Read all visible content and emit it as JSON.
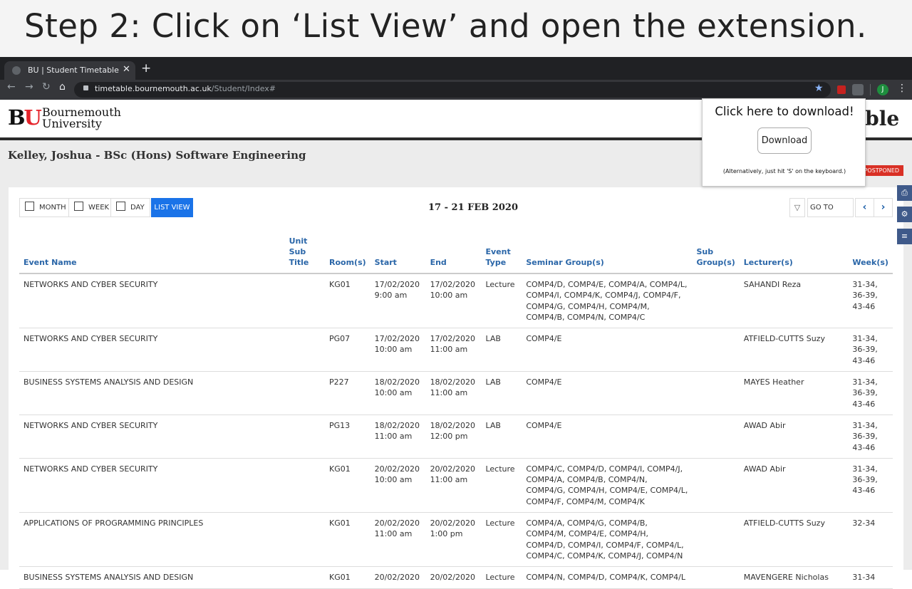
{
  "caption": "Step 2: Click on ‘List View’ and open the extension.",
  "browser": {
    "tab_title": "BU | Student Timetable",
    "url_host": "timetable.bournemouth.ac.uk",
    "url_path": "/Student/Index#",
    "profile_initial": "J"
  },
  "site": {
    "logo_b": "B",
    "logo_u": "U",
    "name_line1": "Bournemouth",
    "name_line2": "University",
    "title_partial": "able"
  },
  "student": "Kelley, Joshua - BSc (Hons) Software Engineering",
  "postponed": "POSTPONED",
  "views": {
    "month": "MONTH",
    "week": "WEEK",
    "day": "DAY",
    "list": "LIST VIEW"
  },
  "date_range": "17 - 21 FEB 2020",
  "goto_placeholder": "GO TO",
  "popup": {
    "title": "Click here to download!",
    "button": "Download",
    "note": "(Alternatively, just hit 'S' on the keyboard.)"
  },
  "table": {
    "headers": [
      "Event Name",
      "Unit Sub Title",
      "Room(s)",
      "Start",
      "End",
      "Event Type",
      "Seminar Group(s)",
      "Sub Group(s)",
      "Lecturer(s)",
      "Week(s)"
    ],
    "rows": [
      {
        "event": "NETWORKS AND CYBER SECURITY",
        "subtitle": "",
        "room": "KG01",
        "start": "17/02/2020 9:00 am",
        "end": "17/02/2020 10:00 am",
        "type": "Lecture",
        "groups": "COMP4/D, COMP4/E, COMP4/A, COMP4/L, COMP4/I, COMP4/K, COMP4/J, COMP4/F, COMP4/G, COMP4/H, COMP4/M, COMP4/B, COMP4/N, COMP4/C",
        "subgroups": "",
        "lecturer": "SAHANDI Reza",
        "weeks": "31-34, 36-39, 43-46"
      },
      {
        "event": "NETWORKS AND CYBER SECURITY",
        "subtitle": "",
        "room": "PG07",
        "start": "17/02/2020 10:00 am",
        "end": "17/02/2020 11:00 am",
        "type": "LAB",
        "groups": "COMP4/E",
        "subgroups": "",
        "lecturer": "ATFIELD-CUTTS Suzy",
        "weeks": "31-34, 36-39, 43-46"
      },
      {
        "event": "BUSINESS SYSTEMS ANALYSIS AND DESIGN",
        "subtitle": "",
        "room": "P227",
        "start": "18/02/2020 10:00 am",
        "end": "18/02/2020 11:00 am",
        "type": "LAB",
        "groups": "COMP4/E",
        "subgroups": "",
        "lecturer": "MAYES Heather",
        "weeks": "31-34, 36-39, 43-46"
      },
      {
        "event": "NETWORKS AND CYBER SECURITY",
        "subtitle": "",
        "room": "PG13",
        "start": "18/02/2020 11:00 am",
        "end": "18/02/2020 12:00 pm",
        "type": "LAB",
        "groups": "COMP4/E",
        "subgroups": "",
        "lecturer": "AWAD Abir",
        "weeks": "31-34, 36-39, 43-46"
      },
      {
        "event": "NETWORKS AND CYBER SECURITY",
        "subtitle": "",
        "room": "KG01",
        "start": "20/02/2020 10:00 am",
        "end": "20/02/2020 11:00 am",
        "type": "Lecture",
        "groups": "COMP4/C, COMP4/D, COMP4/I, COMP4/J, COMP4/A, COMP4/B, COMP4/N, COMP4/G, COMP4/H, COMP4/E, COMP4/L, COMP4/F, COMP4/M, COMP4/K",
        "subgroups": "",
        "lecturer": "AWAD Abir",
        "weeks": "31-34, 36-39, 43-46"
      },
      {
        "event": "APPLICATIONS OF PROGRAMMING PRINCIPLES",
        "subtitle": "",
        "room": "KG01",
        "start": "20/02/2020 11:00 am",
        "end": "20/02/2020 1:00 pm",
        "type": "Lecture",
        "groups": "COMP4/A, COMP4/G, COMP4/B, COMP4/M, COMP4/E, COMP4/H, COMP4/D, COMP4/I, COMP4/F, COMP4/L, COMP4/C, COMP4/K, COMP4/J, COMP4/N",
        "subgroups": "",
        "lecturer": "ATFIELD-CUTTS Suzy",
        "weeks": "32-34"
      },
      {
        "event": "BUSINESS SYSTEMS ANALYSIS AND DESIGN",
        "subtitle": "",
        "room": "KG01",
        "start": "20/02/2020",
        "end": "20/02/2020",
        "type": "Lecture",
        "groups": "COMP4/N, COMP4/D, COMP4/K, COMP4/L",
        "subgroups": "",
        "lecturer": "MAVENGERE Nicholas",
        "weeks": "31-34"
      }
    ]
  }
}
